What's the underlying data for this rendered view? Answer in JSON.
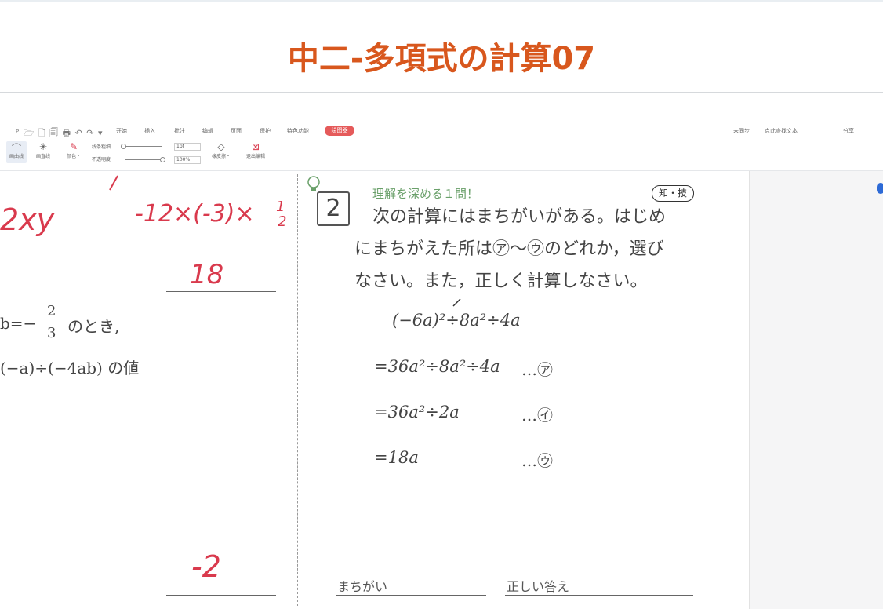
{
  "page_title": "中二-多項式の計算07",
  "toolbar": {
    "quick_icons": "ᴾ  🗁 🗋 🗐 🖶 ↶ ↷ ▾",
    "menus": [
      "开始",
      "插入",
      "批注",
      "编辑",
      "页面",
      "保护",
      "特色功能"
    ],
    "active_menu": "绘图器",
    "right_items": [
      "未同步",
      "点此查找文本",
      "分享"
    ],
    "tools": [
      {
        "label": "画曲线",
        "icon": "⌒"
      },
      {
        "label": "画直线",
        "icon": "✳"
      },
      {
        "label": "颜色・",
        "icon": "✎"
      },
      {
        "label": "线条粗细",
        "icon": ""
      },
      {
        "label": "不透明度",
        "icon": ""
      },
      {
        "label": "橡皮擦・",
        "icon": "◇"
      },
      {
        "label": "退出编辑",
        "icon": "⊠"
      }
    ],
    "thickness_value": "1pt",
    "opacity_value": "100%"
  },
  "left_panel": {
    "handwriting_top": "2xy",
    "handwriting_expr": "-12×(-3)×",
    "handwriting_frac_num": "1",
    "handwriting_frac_den": "2",
    "handwriting_answer1": "18",
    "handwriting_answer2": "-2",
    "condition_prefix": "b=−",
    "condition_num": "2",
    "condition_den": "3",
    "condition_suffix": "のとき,",
    "value_line": "(−a)÷(−4ab) の値"
  },
  "question": {
    "number": "2",
    "heading": "理解を深める１問！",
    "badge": "知・技",
    "line1": "次の計算にはまちがいがある。はじめ",
    "line2": "にまちがえた所は㋐〜㋒のどれか，選び",
    "line3": "なさい。また，正しく計算しなさい。",
    "steps": [
      {
        "expr": "(−6a)²÷8a²÷4a",
        "mark": ""
      },
      {
        "expr": "=36a²÷8a²÷4a",
        "mark": "…㋐"
      },
      {
        "expr": "=36a²÷2a",
        "mark": "…㋑"
      },
      {
        "expr": "=18a",
        "mark": "…㋒"
      }
    ],
    "answer_label_wrong": "まちがい",
    "answer_label_correct": "正しい答え"
  }
}
